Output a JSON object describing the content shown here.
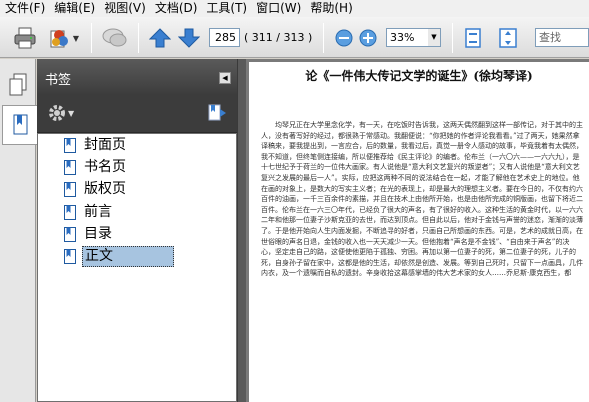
{
  "menu": [
    "文件(F)",
    "编辑(E)",
    "视图(V)",
    "文档(D)",
    "工具(T)",
    "窗口(W)",
    "帮助(H)"
  ],
  "toolbar": {
    "page_current": "285",
    "page_count": "( 311 / 313 )",
    "zoom": "33%",
    "search_placeholder": "查找"
  },
  "sidebar": {
    "title": "书签",
    "items": [
      {
        "label": "封面页"
      },
      {
        "label": "书名页"
      },
      {
        "label": "版权页"
      },
      {
        "label": "前言"
      },
      {
        "label": "目录"
      },
      {
        "label": "正文"
      }
    ]
  },
  "document": {
    "title": "论《一件伟大传记文学的诞生》(徐均琴译)",
    "body": "均琴兄正在大学里念化学，有一天，在吃饭时告诉我，这两天偶然翻到这样一部传记，对于其中的主人，没有著写好的经过，都很熟于常感动。我翻便说：“你把她的作者评论我看看。”过了两天，她果然拿译稿来，要我提出到，一言应合，后的数量，我看过后，真觉一册令人感动的故事，毕竟我着有太偶然，我不知道，但终笔侧连接编，所以便推荐给《民主评论》的编者。伦布兰（一六〇六——一六六九），是十七世纪予于荷兰的一位伟大画家。有人说他是“意大利文艺复兴的叛逆者”；又有人说他是“意大利文艺复兴之发展的最后一人”。实际，应把这两种不同的说法结合在一起，才能了解他在艺术史上的地位。他在画的对象上，是数大的写实主义者；在光的表现上，却是最大的理想主义者。要在今日的，不仅有约六百件的油画，一千三百余件的素描，并且在技术上由他所开始，也是由他所完成的铜版画，也留下将近二百件。伦布兰在一六三〇年代，已经负了很大的声名，有了很好的收入。这种生活的黄金时代，以一六六二年和他那一位妻子沙斯克亚的去世，而达到顶点。但自此以后，他对于金钱与声誉的迷恋，渐渐的淡薄了。于是他开始向人生内面发掘，不断追寻的好者，只画自己所想画的东西。可是，艺术的成就日高，在世俗眼的声名日退，金钱的收入也一天天减少一天。但他抱着“声名是不金钱”、“自由来于声名”的决心，坚定走自己的路，这便使他更陷于孤独、穷困。再加以第一位妻子的死，第二位妻子的死，儿子的死，自身孙子留在家中，这都是他的生活，却依然是创造、发展。等到自己死时，只留下一点画具，几件内衣，及一个遗嘱而自私的遗封。辛身收拾这幕感掌墙的伟大艺术家的女人……乔尼斯·康克西生，都"
  }
}
